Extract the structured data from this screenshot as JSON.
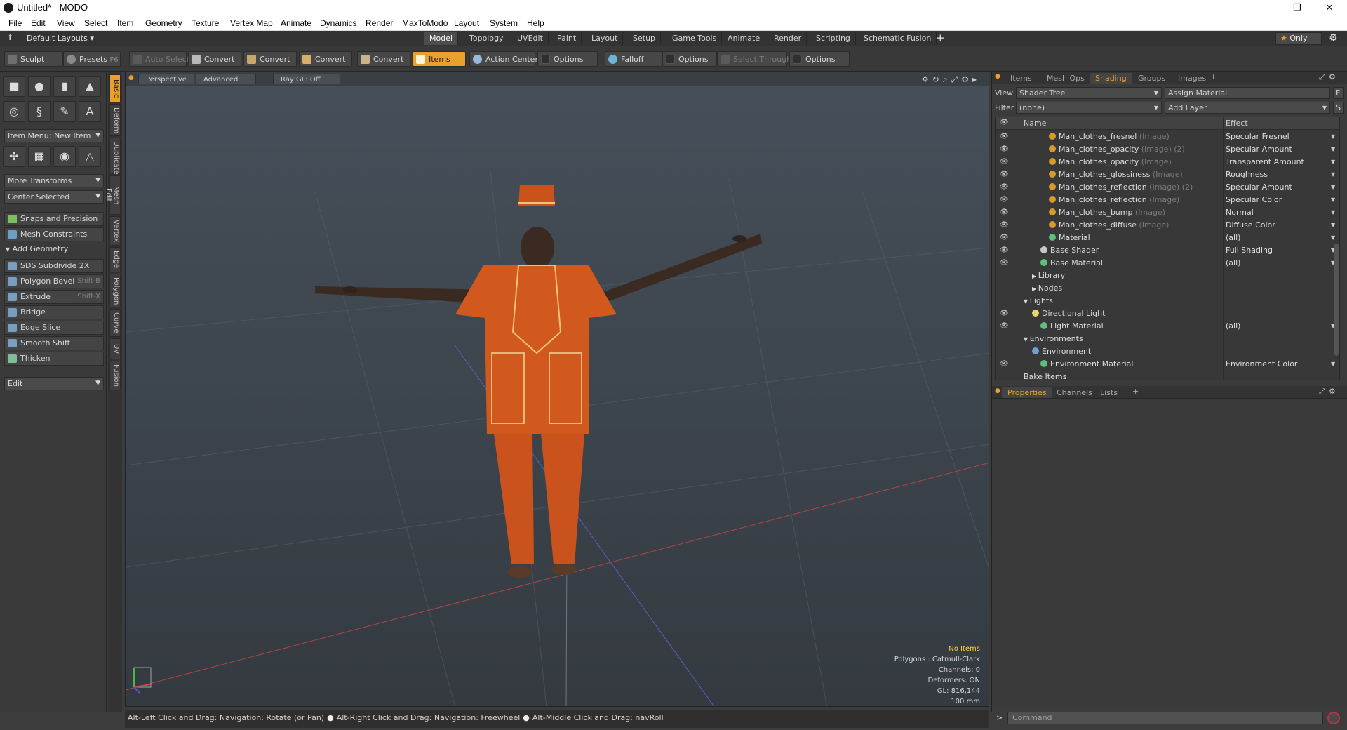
{
  "window": {
    "title": "Untitled* - MODO",
    "controls": {
      "minimize": "—",
      "maximize": "❐",
      "close": "✕"
    }
  },
  "menu": [
    "File",
    "Edit",
    "View",
    "Select",
    "Item",
    "Geometry",
    "Texture",
    "Vertex Map",
    "Animate",
    "Dynamics",
    "Render",
    "MaxToModo",
    "Layout",
    "System",
    "Help"
  ],
  "layoutbar": {
    "layouts_label": "Default Layouts",
    "tabs": [
      "Model",
      "Topology",
      "UVEdit",
      "Paint",
      "Layout",
      "Setup",
      "Game Tools",
      "Animate",
      "Render",
      "Scripting",
      "Schematic Fusion"
    ],
    "active_tab": "Model",
    "add": "+",
    "only": "Only"
  },
  "toolbar": {
    "sculpt": "Sculpt",
    "presets": "Presets",
    "presets_key": "F6",
    "auto_select": "Auto Select",
    "convert": "Convert",
    "items": "Items",
    "action_center": "Action Center",
    "options": "Options",
    "falloff": "Falloff",
    "select_through": "Select Through"
  },
  "left": {
    "item_menu": "Item Menu: New Item",
    "more_transforms": "More Transforms",
    "center_selected": "Center Selected",
    "snaps": "Snaps and Precision",
    "mesh_constraints": "Mesh Constraints",
    "add_geometry": "Add Geometry",
    "tools": [
      {
        "label": "SDS Subdivide 2X",
        "key": ""
      },
      {
        "label": "Polygon Bevel",
        "key": "Shift-B"
      },
      {
        "label": "Extrude",
        "key": "Shift-X"
      },
      {
        "label": "Bridge",
        "key": ""
      },
      {
        "label": "Edge Slice",
        "key": ""
      },
      {
        "label": "Smooth Shift",
        "key": ""
      },
      {
        "label": "Thicken",
        "key": ""
      }
    ],
    "edit": "Edit",
    "vtabs": [
      "Basic",
      "Deform",
      "Duplicate",
      "Mesh Edit",
      "Vertex",
      "Edge",
      "Polygon",
      "Curve",
      "UV",
      "Fusion"
    ]
  },
  "viewport": {
    "perspective": "Perspective",
    "advanced": "Advanced",
    "raygl": "Ray GL: Off",
    "hud": {
      "no_items": "No Items",
      "polygons": "Polygons : Catmull-Clark",
      "channels": "Channels: 0",
      "deformers": "Deformers: ON",
      "gl": "GL: 816,144",
      "scale": "100 mm"
    }
  },
  "status": {
    "hint1": "Alt-Left Click and Drag: Navigation: Rotate (or Pan)",
    "hint2": "Alt-Right Click and Drag: Navigation: Freewheel",
    "hint3": "Alt-Middle Click and Drag: navRoll"
  },
  "right": {
    "tabs": [
      "Items",
      "Mesh Ops",
      "Shading",
      "Groups",
      "Images"
    ],
    "active_tab": "Shading",
    "view_label": "View",
    "view_value": "Shader Tree",
    "assign_material": "Assign Material",
    "filter_label": "Filter",
    "filter_value": "(none)",
    "add_layer": "Add Layer",
    "f_btn": "F",
    "s_btn": "S",
    "col_name": "Name",
    "col_effect": "Effect",
    "rows": [
      {
        "name": "Man_clothes_fresnel",
        "type": "(Image)",
        "effect": "Specular Fresnel",
        "indent": 3,
        "eye": true,
        "kind": "image"
      },
      {
        "name": "Man_clothes_opacity",
        "type": "(Image) (2)",
        "effect": "Specular Amount",
        "indent": 3,
        "eye": true,
        "kind": "image"
      },
      {
        "name": "Man_clothes_opacity",
        "type": "(Image)",
        "effect": "Transparent Amount",
        "indent": 3,
        "eye": true,
        "kind": "image"
      },
      {
        "name": "Man_clothes_glossiness",
        "type": "(Image)",
        "effect": "Roughness",
        "indent": 3,
        "eye": true,
        "kind": "image"
      },
      {
        "name": "Man_clothes_reflection",
        "type": "(Image) (2)",
        "effect": "Specular Amount",
        "indent": 3,
        "eye": true,
        "kind": "image"
      },
      {
        "name": "Man_clothes_reflection",
        "type": "(Image)",
        "effect": "Specular Color",
        "indent": 3,
        "eye": true,
        "kind": "image"
      },
      {
        "name": "Man_clothes_bump",
        "type": "(Image)",
        "effect": "Normal",
        "indent": 3,
        "eye": true,
        "kind": "image"
      },
      {
        "name": "Man_clothes_diffuse",
        "type": "(Image)",
        "effect": "Diffuse Color",
        "indent": 3,
        "eye": true,
        "kind": "image"
      },
      {
        "name": "Material",
        "type": "",
        "effect": "(all)",
        "indent": 3,
        "eye": true,
        "kind": "material"
      },
      {
        "name": "Base Shader",
        "type": "",
        "effect": "Full Shading",
        "indent": 2,
        "eye": true,
        "kind": "shader"
      },
      {
        "name": "Base Material",
        "type": "",
        "effect": "(all)",
        "indent": 2,
        "eye": true,
        "kind": "material"
      },
      {
        "name": "Library",
        "type": "",
        "effect": "",
        "indent": 1,
        "eye": false,
        "kind": "folder"
      },
      {
        "name": "Nodes",
        "type": "",
        "effect": "",
        "indent": 1,
        "eye": false,
        "kind": "folder"
      },
      {
        "name": "Lights",
        "type": "",
        "effect": "",
        "indent": 0,
        "eye": false,
        "kind": "group"
      },
      {
        "name": "Directional Light",
        "type": "",
        "effect": "",
        "indent": 1,
        "eye": true,
        "kind": "light"
      },
      {
        "name": "Light Material",
        "type": "",
        "effect": "(all)",
        "indent": 2,
        "eye": true,
        "kind": "material"
      },
      {
        "name": "Environments",
        "type": "",
        "effect": "",
        "indent": 0,
        "eye": false,
        "kind": "group"
      },
      {
        "name": "Environment",
        "type": "",
        "effect": "",
        "indent": 1,
        "eye": false,
        "kind": "env"
      },
      {
        "name": "Environment Material",
        "type": "",
        "effect": "Environment Color",
        "indent": 2,
        "eye": true,
        "kind": "material"
      },
      {
        "name": "Bake Items",
        "type": "",
        "effect": "",
        "indent": 0,
        "eye": false,
        "kind": "plain"
      }
    ],
    "prop_tabs": [
      "Properties",
      "Channels",
      "Lists"
    ],
    "active_prop_tab": "Properties",
    "command_placeholder": "Command",
    "prompt": ">"
  },
  "colors": {
    "accent": "#e9a02c",
    "warn": "#ffcf40",
    "viewport": "#3d454d"
  }
}
